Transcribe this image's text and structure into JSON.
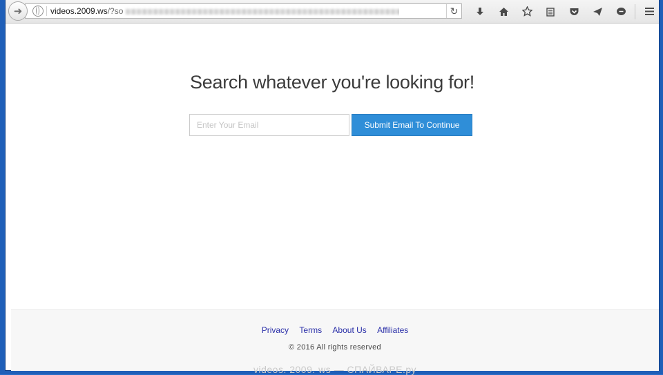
{
  "browser": {
    "url_host": "videos.2009.ws",
    "url_rest": "/?so",
    "icons": {
      "back": "back-arrow-icon",
      "site": "globe-icon",
      "reload": "reload-icon",
      "download": "download-icon",
      "home": "home-icon",
      "bookmark": "star-icon",
      "reading_list": "reading-list-icon",
      "pocket": "pocket-icon",
      "send": "send-icon",
      "chat": "chat-icon",
      "menu": "hamburger-menu-icon"
    }
  },
  "main": {
    "headline": "Search whatever you're looking for!",
    "email_placeholder": "Enter Your Email",
    "email_value": "",
    "submit_label": "Submit Email To Continue"
  },
  "footer": {
    "links": [
      "Privacy",
      "Terms",
      "About Us",
      "Affiliates"
    ],
    "copyright": "© 2016 All rights reserved",
    "watermark": "videos. 2009. ws — СПАЙВАРЕ.ру"
  },
  "colors": {
    "accent": "#2f8ed8",
    "link": "#2a2fa8",
    "desktop": "#1f5fb8"
  }
}
